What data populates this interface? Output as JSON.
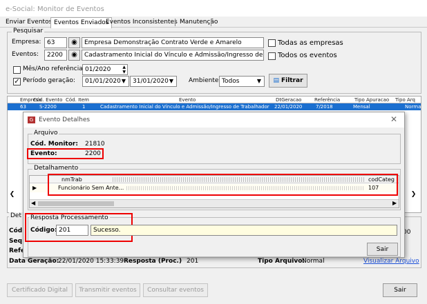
{
  "window": {
    "title": "e-Social: Monitor de Eventos"
  },
  "tabs": [
    "Enviar Eventos",
    "Eventos Enviados",
    "Eventos Inconsistentes",
    "Manutenção"
  ],
  "pesquisar": {
    "title": "Pesquisar",
    "empresa_label": "Empresa:",
    "empresa_code": "63",
    "empresa_name": "Empresa Demonstração Contrato Verde e Amarelo",
    "eventos_label": "Eventos:",
    "eventos_code": "2200",
    "eventos_name": "Cadastramento Inicial do Vínculo e Admissão/Ingresso de Trabalhador",
    "todas_empresas": "Todas as empresas",
    "todos_eventos": "Todos os eventos",
    "mes_ano_label": "Mês/Ano referência:",
    "mes_ano_value": "01/2020",
    "periodo_label": "Período geração:",
    "periodo_checked": true,
    "periodo_de": "01/01/2020",
    "periodo_ate": "31/01/2020",
    "ambiente_label": "Ambiente:",
    "ambiente_value": "Todos",
    "filtrar_label": "Filtrar"
  },
  "grid": {
    "headers": [
      "Empresa",
      "Cód. Evento",
      "Cód. Item",
      "Evento",
      "DtGeracao",
      "Referência",
      "Tipo Apuracao",
      "Tipo Arq"
    ],
    "row": [
      "63",
      "S-2200",
      "1",
      "Cadastramento Inicial do Vínculo e Admissão/Ingresso de Trabalhador",
      "22/01/2020",
      "7/2018",
      "Mensal",
      "Norma"
    ]
  },
  "details": {
    "det_title": "Det",
    "cod_label": "Cód",
    "seq_label": "Seq",
    "ref_label": "Refe",
    "data_geracao_label": "Data Geração:",
    "data_geracao_value": "22/01/2020 15:33:39",
    "resposta_label": "Resposta (Proc.)",
    "resposta_value": "201",
    "tipo_arquivo_label": "Tipo Arquivo:",
    "tipo_arquivo_value": "Normal",
    "visualizar_link": "Visualizar Arquivo",
    "right_value": "00"
  },
  "bottom": {
    "certificado": "Certificado Digital",
    "transmitir": "Transmitir eventos",
    "consultar": "Consultar eventos",
    "sair": "Sair"
  },
  "dialog": {
    "title": "Evento Detalhes",
    "arquivo_title": "Arquivo",
    "cod_monitor_label": "Cód. Monitor:",
    "cod_monitor_value": "21810",
    "evento_label": "Evento:",
    "evento_value": "2200",
    "detalhamento_title": "Detalhamento",
    "col_nmtrab": "nmTrab",
    "col_codcateg": "codCateg",
    "row_nmtrab": "Funcionário Sem Ante...",
    "row_codcateg": "107",
    "resposta_title": "Resposta Processamento",
    "codigo_label": "Código:",
    "codigo_value": "201",
    "mensagem": "Sucesso.",
    "sair": "Sair"
  },
  "colors": {
    "accent": "#1b6fd0",
    "highlight": "#e00000",
    "message_bg": "#fffde0"
  }
}
